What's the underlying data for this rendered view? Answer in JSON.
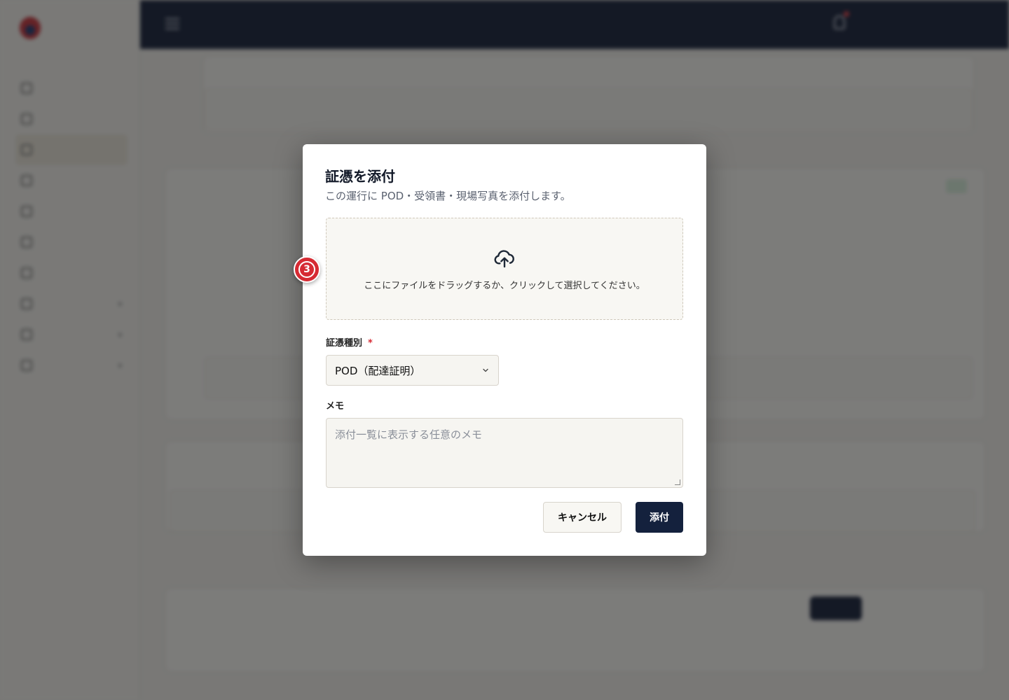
{
  "modal": {
    "title": "証憑を添付",
    "description": "この運行に POD・受領書・現場写真を添付します。",
    "dropzone_text": "ここにファイルをドラッグするか、クリックして選択してください。",
    "step_badge": "3",
    "type_label": "証憑種別",
    "required_mark": "*",
    "type_value": "POD（配達証明）",
    "memo_label": "メモ",
    "memo_placeholder": "添付一覧に表示する任意のメモ",
    "cancel_label": "キャンセル",
    "attach_label": "添付"
  },
  "colors": {
    "primary": "#14213d",
    "danger": "#d62a33",
    "topbar": "#15203a"
  }
}
